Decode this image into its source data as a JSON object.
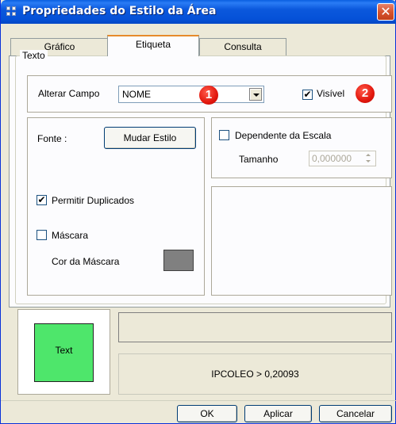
{
  "window": {
    "title": "Propriedades do Estilo da Área",
    "close_glyph": "✕"
  },
  "tabs": [
    {
      "label": "Gráfico",
      "active": false
    },
    {
      "label": "Etiqueta",
      "active": true
    },
    {
      "label": "Consulta",
      "active": false
    }
  ],
  "text_group": {
    "label": "Texto",
    "alterar_campo_label": "Alterar Campo",
    "field_value": "NOME",
    "visible_label": "Visível",
    "visible_checked": true,
    "checked_glyph": "✔"
  },
  "badges": [
    "1",
    "2"
  ],
  "font_panel": {
    "fonte_label": "Fonte :",
    "mudar_estilo_label": "Mudar Estilo",
    "permitir_duplicados_label": "Permitir Duplicados",
    "permitir_duplicados_checked": true,
    "mascara_label": "Máscara",
    "mascara_checked": false,
    "cor_mascara_label": "Cor da Máscara",
    "mask_color": "#808080"
  },
  "scale_panel": {
    "dependente_label": "Dependente da Escala",
    "dependente_checked": false,
    "tamanho_label": "Tamanho",
    "tamanho_value": "0,000000"
  },
  "preview": {
    "text": "Text",
    "fill_color": "#4ee66b"
  },
  "info": {
    "top_text": "",
    "bottom_text": "IPCOLEO > 0,20093"
  },
  "footer": {
    "ok_label": "OK",
    "aplicar_label": "Aplicar",
    "cancelar_label": "Cancelar"
  },
  "colors": {
    "titlebar": "#0551d8",
    "accent_tab": "#e68b2c",
    "badge": "#e2170d"
  }
}
